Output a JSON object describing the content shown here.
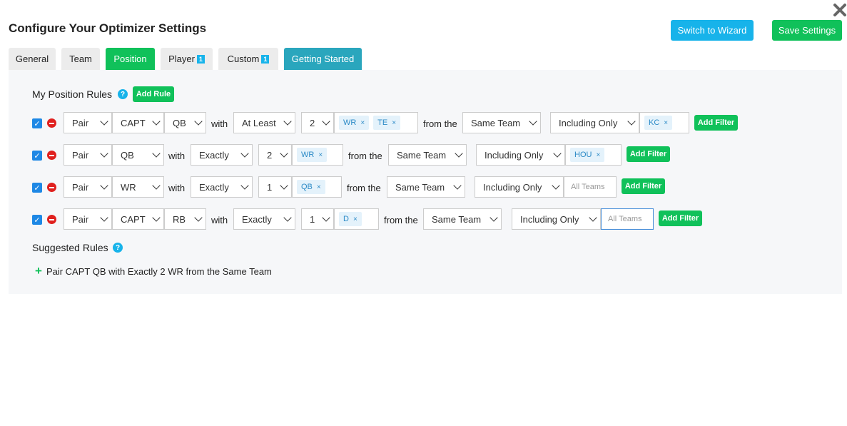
{
  "header": {
    "title": "Configure Your Optimizer Settings",
    "wizard_label": "Switch to Wizard",
    "save_label": "Save Settings",
    "close_icon": "close-icon"
  },
  "tabs": [
    {
      "label": "General"
    },
    {
      "label": "Team"
    },
    {
      "label": "Position",
      "active": true
    },
    {
      "label": "Player",
      "badge": "1"
    },
    {
      "label": "Custom",
      "badge": "1"
    },
    {
      "label": "Getting Started"
    }
  ],
  "position_rules": {
    "heading": "My Position Rules",
    "add_rule_label": "Add Rule",
    "with_label": "with",
    "from_label": "from the",
    "add_filter_label": "Add Filter",
    "rules": [
      {
        "type": "Pair",
        "slot": "CAPT",
        "position": "QB",
        "condition": "At Least",
        "count": "2",
        "targets": [
          "WR",
          "TE"
        ],
        "team": "Same Team",
        "filter": "Including Only",
        "teams": [
          "KC"
        ]
      },
      {
        "type": "Pair",
        "position": "QB",
        "condition": "Exactly",
        "count": "2",
        "targets": [
          "WR"
        ],
        "team": "Same Team",
        "filter": "Including Only",
        "teams": [
          "HOU"
        ]
      },
      {
        "type": "Pair",
        "position": "WR",
        "condition": "Exactly",
        "count": "1",
        "targets": [
          "QB"
        ],
        "team": "Same Team",
        "filter": "Including Only",
        "teams_placeholder": "All Teams"
      },
      {
        "type": "Pair",
        "slot": "CAPT",
        "position": "RB",
        "condition": "Exactly",
        "count": "1",
        "targets": [
          "D"
        ],
        "team": "Same Team",
        "filter": "Including Only",
        "teams_placeholder": "All Teams"
      }
    ]
  },
  "suggested_rules": {
    "heading": "Suggested Rules",
    "items": [
      "Pair CAPT QB with Exactly 2 WR from the Same Team"
    ]
  },
  "colors": {
    "green": "#10c15a",
    "blue": "#17b3ea",
    "teal": "#2aa6bd",
    "remove_red": "#e0201e"
  }
}
